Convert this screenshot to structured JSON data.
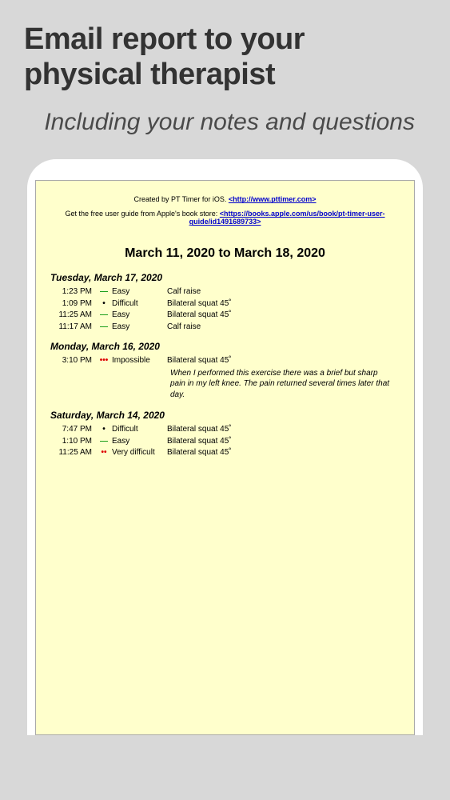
{
  "marketing": {
    "title": "Email report to your physical therapist",
    "subtitle": "Including your notes and questions"
  },
  "report": {
    "header": {
      "created_prefix": "Created by PT Timer for iOS. ",
      "created_link": "<http://www.pttimer.com>",
      "guide_prefix": "Get the free user guide from Apple's book store: ",
      "guide_link": "<https://books.apple.com/us/book/pt-timer-user-guide/id1491689733>"
    },
    "date_range": "March 11, 2020 to March 18, 2020",
    "days": [
      {
        "heading": "Tuesday, March 17, 2020",
        "entries": [
          {
            "time": "1:23 PM",
            "diff_icon": "—",
            "diff_class": "diff-easy",
            "diff_label": "Easy",
            "exercise": "Calf raise"
          },
          {
            "time": "1:09 PM",
            "diff_icon": "•",
            "diff_class": "diff-difficult",
            "diff_label": "Difficult",
            "exercise": "Bilateral squat 45˚"
          },
          {
            "time": "11:25 AM",
            "diff_icon": "—",
            "diff_class": "diff-easy",
            "diff_label": "Easy",
            "exercise": "Bilateral squat 45˚"
          },
          {
            "time": "11:17 AM",
            "diff_icon": "—",
            "diff_class": "diff-easy",
            "diff_label": "Easy",
            "exercise": "Calf raise"
          }
        ]
      },
      {
        "heading": "Monday, March 16, 2020",
        "entries": [
          {
            "time": "3:10 PM",
            "diff_icon": "•••",
            "diff_class": "diff-impossible",
            "diff_label": "Impossible",
            "exercise": "Bilateral squat 45˚",
            "note": "When I performed this exercise there was a brief but sharp pain in my left knee. The pain returned several times later that day."
          }
        ]
      },
      {
        "heading": "Saturday, March 14, 2020",
        "entries": [
          {
            "time": "7:47 PM",
            "diff_icon": "•",
            "diff_class": "diff-difficult",
            "diff_label": "Difficult",
            "exercise": "Bilateral squat 45˚"
          },
          {
            "time": "1:10 PM",
            "diff_icon": "—",
            "diff_class": "diff-easy",
            "diff_label": "Easy",
            "exercise": "Bilateral squat 45˚"
          },
          {
            "time": "11:25 AM",
            "diff_icon": "••",
            "diff_class": "diff-verydifficult",
            "diff_label": "Very difficult",
            "exercise": "Bilateral squat 45˚"
          }
        ]
      }
    ]
  }
}
